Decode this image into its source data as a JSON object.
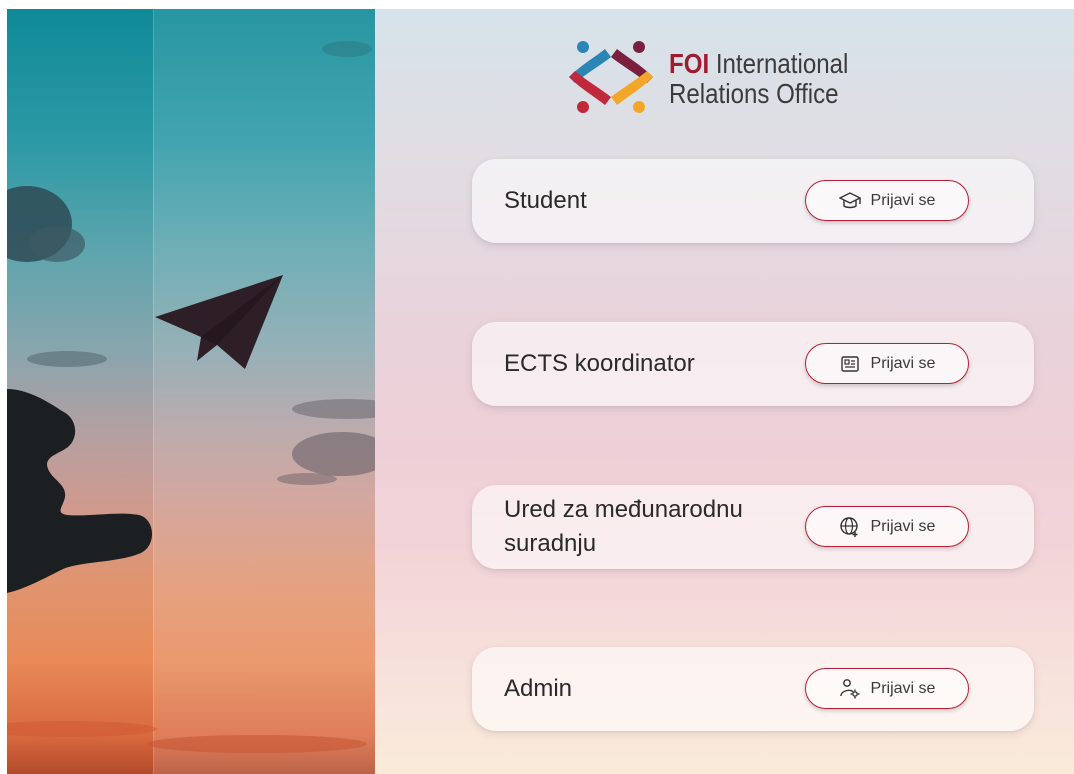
{
  "logo": {
    "brand": "FOI",
    "line1_rest": " International",
    "line2": "Relations Office",
    "colors": {
      "red": "#c0283b",
      "orange": "#f2a72a",
      "blue": "#2b86b6",
      "maroon": "#7a1f3d"
    }
  },
  "roles": [
    {
      "label": "Student",
      "button": "Prijavi se",
      "icon": "graduation-cap-icon"
    },
    {
      "label": "ECTS koordinator",
      "button": "Prijavi se",
      "icon": "id-card-icon"
    },
    {
      "label": "Ured za međunarodnu suradnju",
      "button": "Prijavi se",
      "icon": "globe-add-icon"
    },
    {
      "label": "Admin",
      "button": "Prijavi se",
      "icon": "user-settings-icon"
    }
  ],
  "theme": {
    "accent": "#b81e36"
  }
}
